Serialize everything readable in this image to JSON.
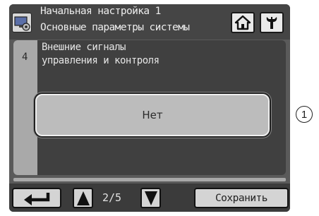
{
  "header": {
    "title_line1": "Начальная настройка 1",
    "title_line2": "Основные параметры системы",
    "icon": "screen-settings-icon",
    "home_icon": "home-icon",
    "settings_icon": "wrench-icon"
  },
  "item": {
    "number": "4",
    "title_line1": "Внешние сигналы",
    "title_line2": "управления и контроля",
    "option_value": "Нет"
  },
  "footer": {
    "back_icon": "return-arrow-icon",
    "up_icon": "up-triangle-icon",
    "down_icon": "down-triangle-icon",
    "page": "2/5",
    "save_label": "Сохранить"
  },
  "callout": "1"
}
